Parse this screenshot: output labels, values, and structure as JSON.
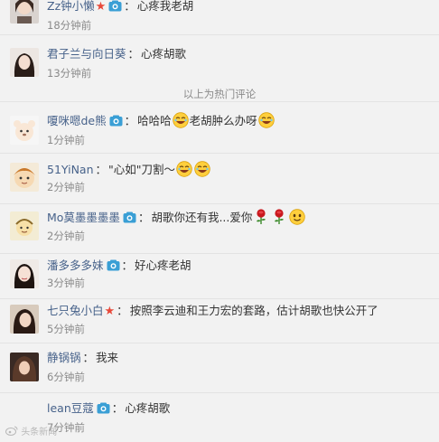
{
  "hot_divider": "以上为热门评论",
  "separator": "：",
  "comments": [
    {
      "user": "Zz钟小懒",
      "text": "心疼我老胡",
      "time": "18分钟前"
    },
    {
      "user": "君子兰与向日葵",
      "text": "心疼胡歌",
      "time": "13分钟前"
    },
    {
      "user": "嗄咪嗯de熊",
      "text_a": "哈哈哈",
      "text_b": "老胡肿么办呀",
      "time": "1分钟前"
    },
    {
      "user": "51YiNan",
      "text": "\"心如\"刀割～",
      "time": "2分钟前"
    },
    {
      "user": "Mo莫墨墨墨墨",
      "text_a": "胡歌你还有我...爱你",
      "time": "2分钟前"
    },
    {
      "user": "潘多多多妹",
      "text": "好心疼老胡",
      "time": "3分钟前"
    },
    {
      "user": "七只兔小白",
      "text": "按照李云迪和王力宏的套路，估计胡歌也快公开了",
      "time": "5分钟前"
    },
    {
      "user": "静锅锅",
      "text": "我来",
      "time": "6分钟前"
    },
    {
      "user": "lean豆蔻",
      "text": "心疼胡歌",
      "time": "7分钟前"
    }
  ],
  "watermark": "头条新闻",
  "colors": {
    "username": "#47628a",
    "timestamp": "#8a8a8a",
    "background": "#f2f2f2",
    "badge": "#3a9fd5",
    "star": "#e8493a"
  },
  "icons": [
    "member-badge-icon",
    "star-icon",
    "laughing-emoji-icon",
    "rose-icon",
    "smile-emoji-icon"
  ]
}
